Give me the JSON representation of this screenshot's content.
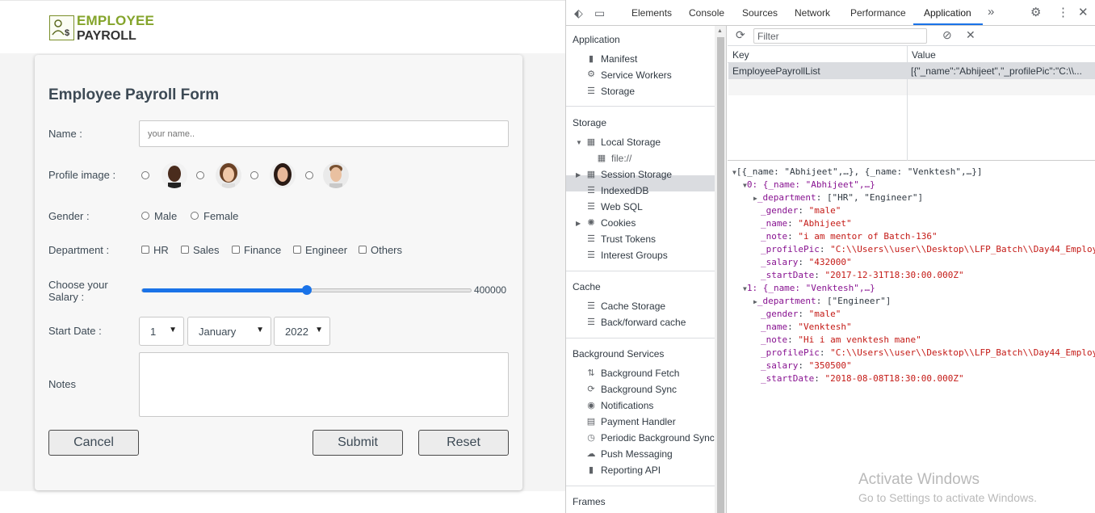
{
  "app": {
    "logo_line1": "EMPLOYEE",
    "logo_line2": "PAYROLL"
  },
  "form": {
    "title": "Employee Payroll Form",
    "name_label": "Name :",
    "name_placeholder": "your name..",
    "profile_label": "Profile image :",
    "gender_label": "Gender :",
    "gender_options": [
      "Male",
      "Female"
    ],
    "department_label": "Department :",
    "department_options": [
      "HR",
      "Sales",
      "Finance",
      "Engineer",
      "Others"
    ],
    "salary_label": "Choose your Salary :",
    "salary_value": "400000",
    "salary_fraction": 0.5,
    "start_date_label": "Start Date :",
    "day": "1",
    "month": "January",
    "year": "2022",
    "notes_label": "Notes",
    "cancel_label": "Cancel",
    "submit_label": "Submit",
    "reset_label": "Reset"
  },
  "devtools": {
    "tabs": [
      "Elements",
      "Console",
      "Sources",
      "Network",
      "Performance",
      "Application"
    ],
    "more_tabs": "»",
    "active_tab": "Application",
    "filter_placeholder": "Filter",
    "sidebar": {
      "application_header": "Application",
      "application_items": [
        "Manifest",
        "Service Workers",
        "Storage"
      ],
      "storage_header": "Storage",
      "local_storage": "Local Storage",
      "file_item": "file://",
      "storage_items": [
        "Session Storage",
        "IndexedDB",
        "Web SQL",
        "Cookies",
        "Trust Tokens",
        "Interest Groups"
      ],
      "cache_header": "Cache",
      "cache_items": [
        "Cache Storage",
        "Back/forward cache"
      ],
      "bg_header": "Background Services",
      "bg_items": [
        "Background Fetch",
        "Background Sync",
        "Notifications",
        "Payment Handler",
        "Periodic Background Sync",
        "Push Messaging",
        "Reporting API"
      ],
      "frames_header": "Frames"
    },
    "table": {
      "key_header": "Key",
      "value_header": "Value",
      "rows": [
        {
          "key": "EmployeePayrollList",
          "value": "[{\"_name\":\"Abhijeet\",\"_profilePic\":\"C:\\\\..."
        }
      ]
    },
    "json_lines": [
      {
        "text": "[{_name: \"Abhijeet\",…}, {_name: \"Venktesh\",…}]"
      },
      {
        "text": "0: {_name: \"Abhijeet\",…}"
      },
      {
        "key": "_department",
        "value": "[\"HR\", \"Engineer\"]"
      },
      {
        "key": "_gender",
        "value": "\"male\""
      },
      {
        "key": "_name",
        "value": "\"Abhijeet\""
      },
      {
        "key": "_note",
        "value": "\"i am mentor of Batch-136\""
      },
      {
        "key": "_profilePic",
        "value": "\"C:\\\\Users\\\\user\\\\Desktop\\\\LFP_Batch\\\\Day44_Employ"
      },
      {
        "key": "_salary",
        "value": "\"432000\""
      },
      {
        "key": "_startDate",
        "value": "\"2017-12-31T18:30:00.000Z\""
      },
      {
        "text": "1: {_name: \"Venktesh\",…}"
      },
      {
        "key": "_department",
        "value": "[\"Engineer\"]"
      },
      {
        "key": "_gender",
        "value": "\"male\""
      },
      {
        "key": "_name",
        "value": "\"Venktesh\""
      },
      {
        "key": "_note",
        "value": "\"Hi i am venktesh mane\""
      },
      {
        "key": "_profilePic",
        "value": "\"C:\\\\Users\\\\user\\\\Desktop\\\\LFP_Batch\\\\Day44_Employ"
      },
      {
        "key": "_salary",
        "value": "\"350500\""
      },
      {
        "key": "_startDate",
        "value": "\"2018-08-08T18:30:00.000Z\""
      }
    ]
  },
  "watermark": {
    "line1": "Activate Windows",
    "line2": "Go to Settings to activate Windows."
  }
}
